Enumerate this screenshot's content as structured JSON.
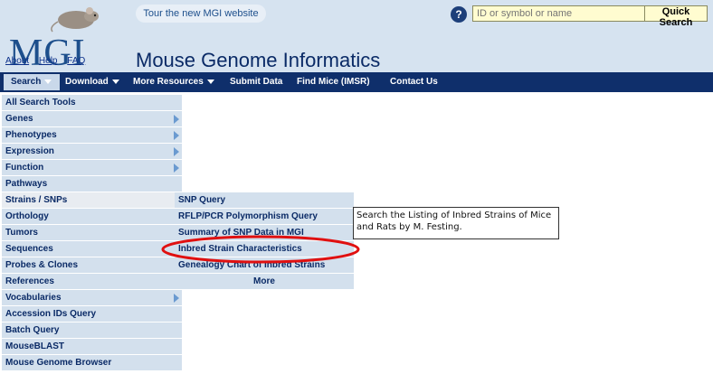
{
  "header": {
    "logo_text": "MGI",
    "links": [
      "About",
      "Help",
      "FAQ"
    ],
    "site_title": "Mouse Genome Informatics",
    "tour_label": "Tour the new MGI website",
    "help_icon_glyph": "?",
    "quick_search_placeholder": "ID or symbol or name",
    "quick_search_button": "Quick Search"
  },
  "nav": {
    "items": [
      "Search",
      "Download",
      "More Resources",
      "Submit Data",
      "Find Mice (IMSR)",
      "Contact Us"
    ]
  },
  "left_menu": {
    "items": [
      "All Search Tools",
      "Genes",
      "Phenotypes",
      "Expression",
      "Function",
      "Pathways",
      "Strains / SNPs",
      "Orthology",
      "Tumors",
      "Sequences",
      "Probes & Clones",
      "References",
      "Vocabularies",
      "Accession IDs Query",
      "Batch Query",
      "MouseBLAST",
      "Mouse Genome Browser"
    ]
  },
  "submenu": {
    "items": [
      "SNP Query",
      "RFLP/PCR Polymorphism Query",
      "Summary of SNP Data in MGI",
      "Inbred Strain Characteristics",
      "Genealogy Chart of Inbred Strains",
      "More"
    ]
  },
  "tooltip": {
    "text": "Search the Listing of Inbred Strains of Mice and Rats by M. Festing."
  },
  "colors": {
    "header_bg": "#d6e3f0",
    "nav_bg": "#0f2f6b",
    "menu_bg": "#d3e0ed",
    "highlight": "#e01010"
  }
}
